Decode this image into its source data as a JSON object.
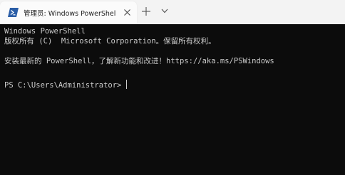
{
  "tab": {
    "title": "管理员: Windows PowerShell",
    "icon": "powershell-icon"
  },
  "tabbar": {
    "new_tab_icon": "plus-icon",
    "dropdown_icon": "chevron-down-icon",
    "close_icon": "close-icon"
  },
  "terminal": {
    "lines": [
      "Windows PowerShell",
      "版权所有 (C)  Microsoft Corporation。保留所有权利。",
      "",
      "安装最新的 PowerShell，了解新功能和改进！https://aka.ms/PSWindows",
      "",
      "PS C:\\Users\\Administrator>"
    ]
  },
  "colors": {
    "terminal_bg": "#0c0c0c",
    "terminal_fg": "#cccccc",
    "tabbar_bg": "#f3f3f3",
    "tab_bg": "#fbfbfb",
    "icon_blue": "#2b5ea7"
  }
}
